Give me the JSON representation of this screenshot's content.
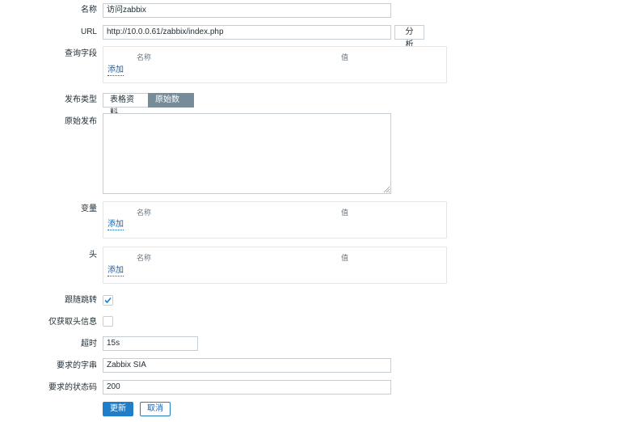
{
  "form": {
    "name": {
      "label": "名称",
      "value": "访问zabbix"
    },
    "url": {
      "label": "URL",
      "value": "http://10.0.0.61/zabbix/index.php",
      "parse_button": "分析"
    },
    "query_fields": {
      "label": "查询字段",
      "col_name": "名称",
      "col_value": "值",
      "add": "添加"
    },
    "post_type": {
      "label": "发布类型",
      "options": [
        "表格资料",
        "原始数据"
      ],
      "selected": "原始数据"
    },
    "raw_post": {
      "label": "原始发布",
      "value": ""
    },
    "variables": {
      "label": "变量",
      "col_name": "名称",
      "col_value": "值",
      "add": "添加"
    },
    "headers": {
      "label": "头",
      "col_name": "名称",
      "col_value": "值",
      "add": "添加"
    },
    "follow_redirects": {
      "label": "跟随跳转",
      "checked": true
    },
    "retrieve_headers_only": {
      "label": "仅获取头信息",
      "checked": false
    },
    "timeout": {
      "label": "超时",
      "value": "15s"
    },
    "required_string": {
      "label": "要求的字串",
      "value": "Zabbix SIA"
    },
    "required_status_codes": {
      "label": "要求的状态码",
      "value": "200"
    },
    "buttons": {
      "update": "更新",
      "cancel": "取消"
    }
  },
  "colors": {
    "primary": "#1f7ec7",
    "segment_active": "#768d99",
    "link": "#1f62a8"
  },
  "icons": {
    "checkmark": "check-icon",
    "resize": "resize-grip-icon"
  }
}
